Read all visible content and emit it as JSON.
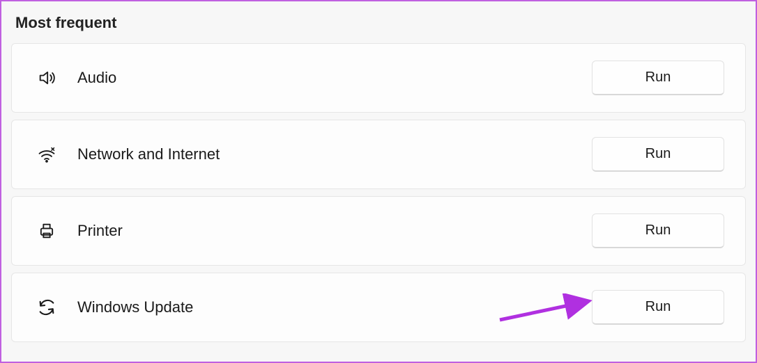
{
  "section_title": "Most frequent",
  "items": [
    {
      "label": "Audio",
      "icon": "speaker-icon",
      "button": "Run"
    },
    {
      "label": "Network and Internet",
      "icon": "wifi-icon",
      "button": "Run"
    },
    {
      "label": "Printer",
      "icon": "printer-icon",
      "button": "Run"
    },
    {
      "label": "Windows Update",
      "icon": "refresh-icon",
      "button": "Run"
    }
  ],
  "annotation": {
    "arrow_color": "#b030e0"
  }
}
